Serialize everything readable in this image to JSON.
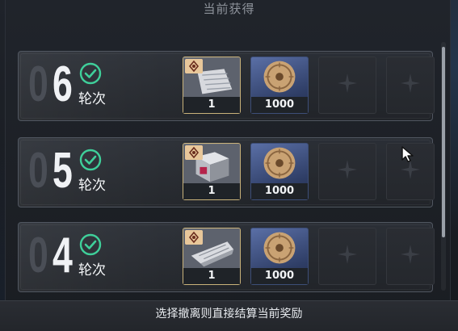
{
  "header": {
    "title": "当前获得"
  },
  "rounds": [
    {
      "number_prefix": "0",
      "number_main": "6",
      "label": "轮次",
      "item1_count": "1",
      "item2_count": "1000"
    },
    {
      "number_prefix": "0",
      "number_main": "5",
      "label": "轮次",
      "item1_count": "1",
      "item2_count": "1000"
    },
    {
      "number_prefix": "0",
      "number_main": "4",
      "label": "轮次",
      "item1_count": "1",
      "item2_count": "1000"
    }
  ],
  "footer": {
    "hint": "选择撤离则直接结算当前奖励"
  },
  "colors": {
    "check": "#3fcf9a",
    "rare_border": "#c9b27a",
    "badge": "#e8c79a"
  },
  "icons": {
    "check": "check-circle-icon",
    "empty_slot": "four-point-star-icon",
    "coin": "coin-icon",
    "badge": "rarity-badge-icon"
  }
}
